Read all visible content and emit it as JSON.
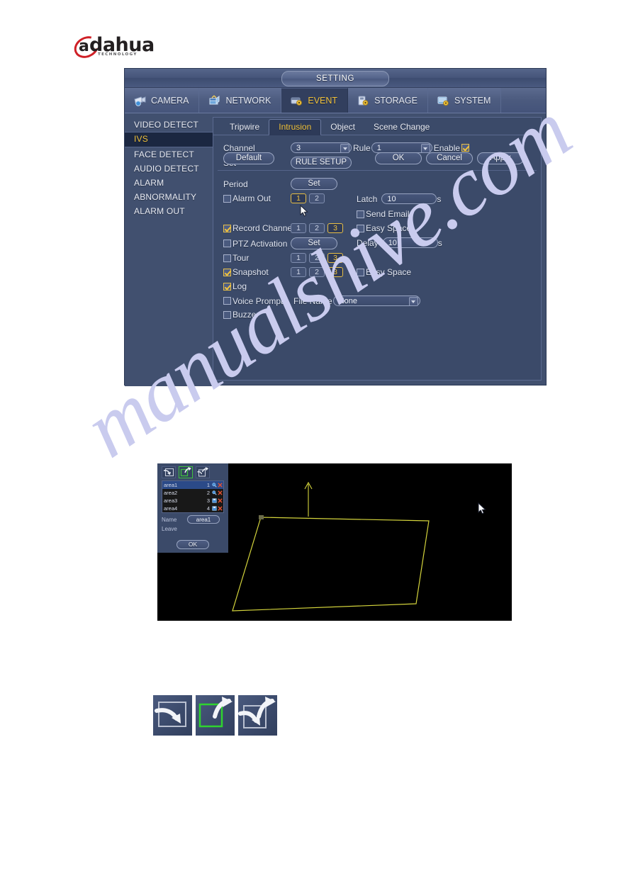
{
  "brand": {
    "name": "dahua",
    "initial": "a",
    "tagline": "TECHNOLOGY"
  },
  "watermark": "manualshive.com",
  "window": {
    "title": "SETTING",
    "top_tabs": [
      {
        "label": "CAMERA",
        "icon": "camera-icon",
        "active": false
      },
      {
        "label": "NETWORK",
        "icon": "network-icon",
        "active": false
      },
      {
        "label": "EVENT",
        "icon": "event-icon",
        "active": true
      },
      {
        "label": "STORAGE",
        "icon": "storage-icon",
        "active": false
      },
      {
        "label": "SYSTEM",
        "icon": "system-icon",
        "active": false
      }
    ],
    "sidebar": [
      {
        "label": "VIDEO DETECT",
        "active": false
      },
      {
        "label": "IVS",
        "active": true
      },
      {
        "label": "FACE DETECT",
        "active": false
      },
      {
        "label": "AUDIO DETECT",
        "active": false
      },
      {
        "label": "ALARM",
        "active": false
      },
      {
        "label": "ABNORMALITY",
        "active": false
      },
      {
        "label": "ALARM OUT",
        "active": false
      }
    ],
    "sub_tabs": [
      {
        "label": "Tripwire",
        "active": false
      },
      {
        "label": "Intrusion",
        "active": true
      },
      {
        "label": "Object",
        "active": false
      },
      {
        "label": "Scene Change",
        "active": false
      }
    ],
    "form": {
      "channel_label": "Channel",
      "channel_value": "3",
      "rule_label": "Rule",
      "rule_value": "1",
      "enable_label": "Enable",
      "enable_checked": true,
      "set_label": "Set",
      "rule_setup_label": "RULE SETUP",
      "period_label": "Period",
      "period_btn": "Set",
      "alarm_out_label": "Alarm Out",
      "alarm_out_checked": false,
      "alarm_out_boxes": [
        {
          "num": "1",
          "selected": true
        },
        {
          "num": "2",
          "selected": false
        }
      ],
      "latch_label": "Latch",
      "latch_value": "10",
      "latch_unit": "s",
      "send_email_label": "Send Email",
      "send_email_checked": false,
      "record_channel_label": "Record Channel",
      "record_channel_checked": true,
      "record_channel_boxes": [
        {
          "num": "1",
          "selected": false
        },
        {
          "num": "2",
          "selected": false
        },
        {
          "num": "3",
          "selected": true
        }
      ],
      "easy_space_label": "Easy Space",
      "record_easy_space_checked": false,
      "ptz_label": "PTZ Activation",
      "ptz_checked": false,
      "ptz_btn": "Set",
      "delay_label": "Delay",
      "delay_value": "10",
      "delay_unit": "s",
      "tour_label": "Tour",
      "tour_checked": false,
      "tour_boxes": [
        {
          "num": "1",
          "selected": false
        },
        {
          "num": "2",
          "selected": false
        },
        {
          "num": "3",
          "selected": true
        }
      ],
      "snapshot_label": "Snapshot",
      "snapshot_checked": true,
      "snapshot_boxes": [
        {
          "num": "1",
          "selected": false
        },
        {
          "num": "2",
          "selected": false
        },
        {
          "num": "3",
          "selected": true
        }
      ],
      "snapshot_easy_space_checked": false,
      "log_label": "Log",
      "log_checked": true,
      "voice_prompts_label": "Voice Prompts",
      "voice_prompts_checked": false,
      "file_name_label": "File Name",
      "file_name_value": "None",
      "buzzer_label": "Buzzer",
      "buzzer_checked": false
    },
    "buttons": {
      "default": "Default",
      "ok": "OK",
      "cancel": "Cancel",
      "apply": "Apply"
    }
  },
  "preview": {
    "tools": [
      {
        "icon": "arrow-enter-icon",
        "active": false
      },
      {
        "icon": "arrow-exit-icon",
        "active": true
      },
      {
        "icon": "arrow-both-icon",
        "active": false
      }
    ],
    "areas": [
      {
        "name": "area1",
        "num": "1",
        "selected": true
      },
      {
        "name": "area2",
        "num": "2",
        "selected": false
      },
      {
        "name": "area3",
        "num": "3",
        "selected": false
      },
      {
        "name": "area4",
        "num": "4",
        "selected": false
      }
    ],
    "name_label": "Name",
    "name_value": "area1",
    "leave_label": "Leave",
    "ok_label": "OK",
    "region_color": "#d4d43c"
  },
  "legend_icons": [
    {
      "icon": "direction-enter-icon",
      "highlight": false
    },
    {
      "icon": "direction-exit-icon",
      "highlight": true
    },
    {
      "icon": "direction-both-icon",
      "highlight": false
    }
  ]
}
